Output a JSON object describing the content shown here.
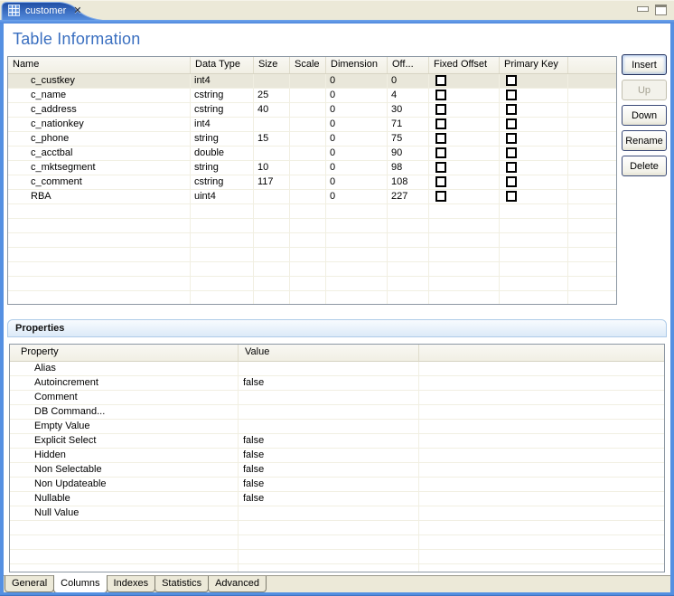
{
  "window": {
    "tab_title": "customer",
    "close_glyph": "✕",
    "controls": {
      "minimize": "minimize",
      "maximize": "maximize"
    }
  },
  "page": {
    "title": "Table Information"
  },
  "columns_table": {
    "headers": [
      "Name",
      "Data Type",
      "Size",
      "Scale",
      "Dimension",
      "Off...",
      "Fixed Offset",
      "Primary Key",
      ""
    ],
    "rows": [
      {
        "name": "c_custkey",
        "data_type": "int4",
        "size": "",
        "scale": "",
        "dimension": "0",
        "offset": "0",
        "fixed_offset": false,
        "primary_key": false,
        "selected": true
      },
      {
        "name": "c_name",
        "data_type": "cstring",
        "size": "25",
        "scale": "",
        "dimension": "0",
        "offset": "4",
        "fixed_offset": false,
        "primary_key": false
      },
      {
        "name": "c_address",
        "data_type": "cstring",
        "size": "40",
        "scale": "",
        "dimension": "0",
        "offset": "30",
        "fixed_offset": false,
        "primary_key": false
      },
      {
        "name": "c_nationkey",
        "data_type": "int4",
        "size": "",
        "scale": "",
        "dimension": "0",
        "offset": "71",
        "fixed_offset": false,
        "primary_key": false
      },
      {
        "name": "c_phone",
        "data_type": "string",
        "size": "15",
        "scale": "",
        "dimension": "0",
        "offset": "75",
        "fixed_offset": false,
        "primary_key": false
      },
      {
        "name": "c_acctbal",
        "data_type": "double",
        "size": "",
        "scale": "",
        "dimension": "0",
        "offset": "90",
        "fixed_offset": false,
        "primary_key": false
      },
      {
        "name": "c_mktsegment",
        "data_type": "string",
        "size": "10",
        "scale": "",
        "dimension": "0",
        "offset": "98",
        "fixed_offset": false,
        "primary_key": false
      },
      {
        "name": "c_comment",
        "data_type": "cstring",
        "size": "117",
        "scale": "",
        "dimension": "0",
        "offset": "108",
        "fixed_offset": false,
        "primary_key": false
      },
      {
        "name": "RBA",
        "data_type": "uint4",
        "size": "",
        "scale": "",
        "dimension": "0",
        "offset": "227",
        "fixed_offset": false,
        "primary_key": false
      }
    ],
    "empty_filler_rows": 7
  },
  "buttons": [
    {
      "label": "Insert",
      "enabled": true,
      "default": true
    },
    {
      "label": "Up",
      "enabled": false,
      "default": false
    },
    {
      "label": "Down",
      "enabled": true,
      "default": false
    },
    {
      "label": "Rename",
      "enabled": true,
      "default": false
    },
    {
      "label": "Delete",
      "enabled": true,
      "default": false
    }
  ],
  "properties": {
    "section_title": "Properties",
    "headers": [
      "Property",
      "Value"
    ],
    "rows": [
      {
        "property": "Alias",
        "value": ""
      },
      {
        "property": "Autoincrement",
        "value": "false"
      },
      {
        "property": "Comment",
        "value": ""
      },
      {
        "property": "DB Command...",
        "value": ""
      },
      {
        "property": "Empty Value",
        "value": ""
      },
      {
        "property": "Explicit Select",
        "value": "false"
      },
      {
        "property": "Hidden",
        "value": "false"
      },
      {
        "property": "Non Selectable",
        "value": "false"
      },
      {
        "property": "Non Updateable",
        "value": "false"
      },
      {
        "property": "Nullable",
        "value": "false"
      },
      {
        "property": "Null Value",
        "value": ""
      }
    ],
    "empty_filler_rows": 4
  },
  "bottom_tabs": [
    {
      "label": "General",
      "selected": false
    },
    {
      "label": "Columns",
      "selected": true
    },
    {
      "label": "Indexes",
      "selected": false
    },
    {
      "label": "Statistics",
      "selected": false
    },
    {
      "label": "Advanced",
      "selected": false
    }
  ],
  "colors": {
    "window_border": "#5590E2",
    "tab_gradient_top": "#1F4DA3",
    "tab_gradient_bottom": "#5890E0",
    "title_text": "#3A6FC0",
    "chrome_background": "#ECE9D8",
    "selected_row": "#E9E7DA",
    "table_border": "#8C97A3",
    "props_titlebar": "#DCEAF8"
  }
}
